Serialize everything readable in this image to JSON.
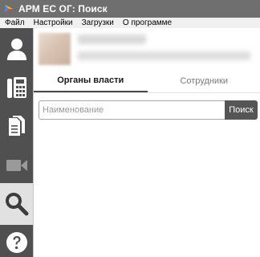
{
  "window": {
    "title": "АРМ ЕС ОГ: Поиск"
  },
  "menu": {
    "items": [
      "Файл",
      "Настройки",
      "Загрузки",
      "О программе"
    ]
  },
  "sidebar": {
    "items": [
      {
        "icon": "user-icon",
        "active": false
      },
      {
        "icon": "phone-icon",
        "active": false
      },
      {
        "icon": "documents-icon",
        "active": false
      },
      {
        "icon": "video-camera-icon",
        "active": false
      },
      {
        "icon": "search-icon",
        "active": true
      },
      {
        "icon": "help-icon",
        "active": false
      }
    ]
  },
  "tabs": [
    {
      "label": "Органы власти",
      "active": true
    },
    {
      "label": "Сотрудники",
      "active": false
    }
  ],
  "search": {
    "placeholder": "Наименование",
    "value": "",
    "button_label": "Поиск"
  },
  "colors": {
    "titlebar": "#6f6f6f",
    "sidebar": "#505050",
    "sidebar_active": "#e1e1e1",
    "search_button": "#555555"
  }
}
